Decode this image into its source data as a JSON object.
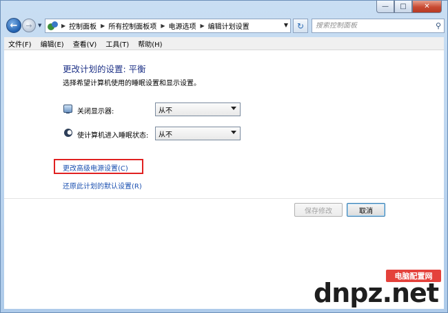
{
  "window": {
    "caption_min": "—",
    "caption_max": "□",
    "caption_close": "✕"
  },
  "address_bar": {
    "crumbs": [
      "控制面板",
      "所有控制面板项",
      "电源选项",
      "编辑计划设置"
    ],
    "search_placeholder": "搜索控制面板"
  },
  "menu": [
    "文件(F)",
    "编辑(E)",
    "查看(V)",
    "工具(T)",
    "帮助(H)"
  ],
  "page": {
    "title": "更改计划的设置: 平衡",
    "subtitle": "选择希望计算机使用的睡眠设置和显示设置。",
    "settings": [
      {
        "label": "关闭显示器:",
        "value": "从不",
        "icon": "monitor-icon"
      },
      {
        "label": "使计算机进入睡眠状态:",
        "value": "从不",
        "icon": "moon-icon"
      }
    ],
    "links": {
      "advanced": "更改高级电源设置(C)",
      "restore": "还原此计划的默认设置(R)"
    },
    "buttons": {
      "save": "保存修改",
      "cancel": "取消"
    }
  },
  "watermark": {
    "badge": "电脑配置网",
    "text": "dnpz.net"
  },
  "colors": {
    "title_blue": "#1e3287",
    "link_blue": "#1a4fb0",
    "highlight_red": "#e02020",
    "window_frame": "#b9d3ee"
  }
}
